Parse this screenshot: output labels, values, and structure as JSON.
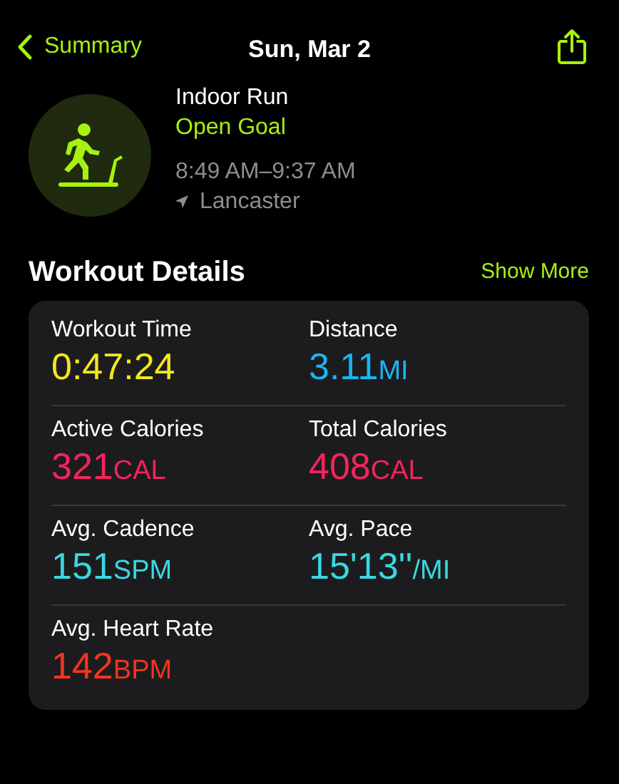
{
  "nav": {
    "back_label": "Summary",
    "title": "Sun, Mar 2"
  },
  "workout": {
    "name": "Indoor Run",
    "goal": "Open Goal",
    "time_range": "8:49 AM–9:37 AM",
    "location": "Lancaster"
  },
  "section": {
    "title": "Workout Details",
    "action": "Show More"
  },
  "metrics": [
    {
      "label": "Workout Time",
      "value": "0:47:24",
      "color": "#f5e61c"
    },
    {
      "label": "Distance",
      "value": "3.11",
      "unit": "MI",
      "color": "#19b6f4"
    },
    {
      "label": "Active Calories",
      "value": "321",
      "unit": "CAL",
      "color": "#f5245a"
    },
    {
      "label": "Total Calories",
      "value": "408",
      "unit": "CAL",
      "color": "#f5245a"
    },
    {
      "label": "Avg. Cadence",
      "value": "151",
      "unit": "SPM",
      "color": "#3ad8e0"
    },
    {
      "label": "Avg. Pace",
      "value": "15'13''",
      "unit": "/MI",
      "color": "#3ad8e0"
    },
    {
      "label": "Avg. Heart Rate",
      "value": "142",
      "unit": "BPM",
      "color": "#f5331f"
    }
  ]
}
